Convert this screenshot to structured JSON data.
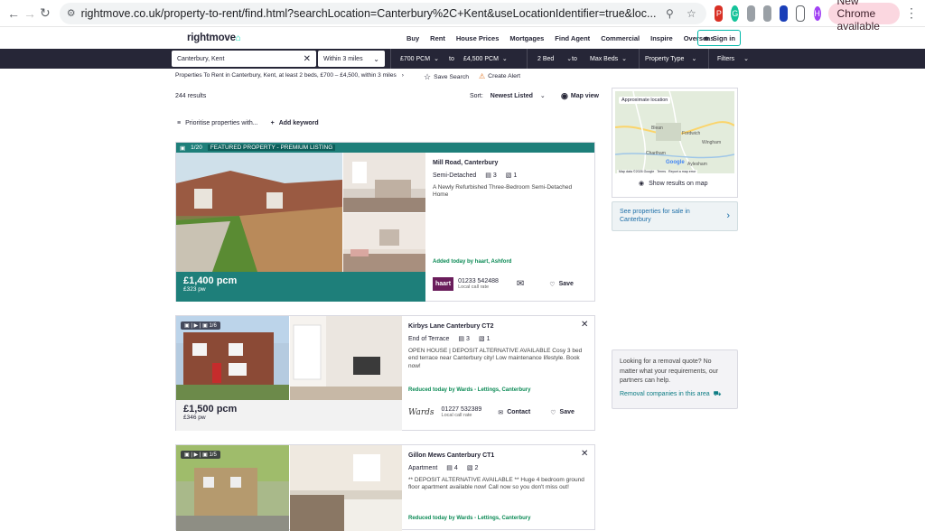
{
  "browser": {
    "url": "rightmove.co.uk/property-to-rent/find.html?searchLocation=Canterbury%2C+Kent&useLocationIdentifier=true&loc...",
    "new_chrome": "New Chrome available",
    "avatar_letter": "H"
  },
  "header": {
    "logo": "rightmove",
    "nav": [
      "Buy",
      "Rent",
      "House Prices",
      "Mortgages",
      "Find Agent",
      "Commercial",
      "Inspire",
      "Overseas"
    ],
    "sign_in": "Sign in"
  },
  "searchbar": {
    "location": "Canterbury, Kent",
    "radius": "Within 3 miles",
    "min_price": "£700 PCM",
    "to1": "to",
    "max_price": "£4,500 PCM",
    "min_beds": "2 Bed",
    "to2": "to",
    "max_beds": "Max Beds",
    "property_type": "Property Type",
    "filters": "Filters"
  },
  "breadcrumb": "Properties To Rent in Canterbury, Kent, at least 2 beds, £700 – £4,500, within 3 miles",
  "save_search": "Save Search",
  "create_alert": "Create Alert",
  "results_count": "244 results",
  "sort": {
    "label": "Sort:",
    "value": "Newest Listed"
  },
  "map_view": "Map view",
  "prioritise": "Prioritise properties with...",
  "add_keyword": "Add keyword",
  "listings": [
    {
      "featured_label": "FEATURED PROPERTY - PREMIUM LISTING",
      "photo_count": "1/20",
      "address": "Mill Road, Canterbury",
      "type": "Semi-Detached",
      "beds": "3",
      "baths": "1",
      "description": "A Newly Refurbished Three-Bedroom Semi-Detached Home",
      "added": "Added today by haart, Ashford",
      "price": "£1,400 pcm",
      "price_pw": "£323 pw",
      "agent_logo": "haart",
      "phone": "01233 542488",
      "phone_note": "Local call rate",
      "save": "Save"
    },
    {
      "photo_count": "1/6",
      "address": "Kirbys Lane Canterbury CT2",
      "type": "End of Terrace",
      "beds": "3",
      "baths": "1",
      "description": "OPEN HOUSE | DEPOSIT ALTERNATIVE AVAILABLE Cosy 3 bed end terrace near Canterbury city! Low maintenance lifestyle. Book now!",
      "added": "Reduced today by Wards - Lettings, Canterbury",
      "price": "£1,500 pcm",
      "price_pw": "£346 pw",
      "agent_logo": "Wards",
      "phone": "01227 532389",
      "phone_note": "Local call rate",
      "contact": "Contact",
      "save": "Save"
    },
    {
      "photo_count": "1/5",
      "address": "Gillon Mews Canterbury CT1",
      "type": "Apartment",
      "beds": "4",
      "baths": "2",
      "description": "** DEPOSIT ALTERNATIVE AVAILABLE ** Huge 4 bedroom ground floor apartment available now! Call now so you don't miss out!",
      "added": "Reduced today by Wards - Lettings, Canterbury"
    }
  ],
  "sidebar": {
    "map_label": "Approximate location",
    "map_places": [
      "Blean",
      "Fordwich",
      "Wingham",
      "Chartham",
      "Aylesham"
    ],
    "map_footer": "Map data ©2026 Google",
    "map_terms": "Terms",
    "map_report": "Report a map error",
    "map_brand": "Google",
    "show_results": "Show results on map",
    "sales_link": "See properties for sale in Canterbury",
    "removal_text": "Looking for a removal quote? No matter what your requirements, our partners can help.",
    "removal_link": "Removal companies in this area"
  },
  "colors": {
    "nav_dark": "#262637",
    "featured_teal": "#1e7f7a",
    "added_green": "#0b8a55",
    "link_blue": "#1e6fa8"
  }
}
